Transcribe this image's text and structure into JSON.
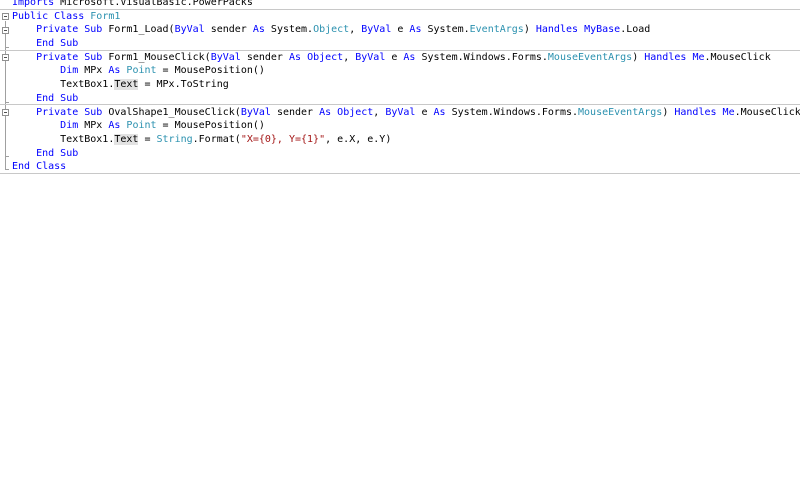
{
  "editor": {
    "language": "VB.NET",
    "colors": {
      "keyword": "#0000ff",
      "type": "#2b91af",
      "string": "#a31515",
      "text": "#000000",
      "highlight": "#e2e2e2"
    },
    "lines": [
      [
        [
          "kw",
          "Imports"
        ],
        [
          "t",
          " Microsoft.VisualBasic.PowerPacks"
        ]
      ],
      [
        [
          "kw",
          "Public Class"
        ],
        [
          "t",
          " "
        ],
        [
          "ty",
          "Form1"
        ]
      ],
      [
        [
          "t",
          "    "
        ],
        [
          "kw",
          "Private Sub"
        ],
        [
          "t",
          " Form1_Load("
        ],
        [
          "kw",
          "ByVal"
        ],
        [
          "t",
          " sender "
        ],
        [
          "kw",
          "As"
        ],
        [
          "t",
          " System."
        ],
        [
          "ty",
          "Object"
        ],
        [
          "t",
          ", "
        ],
        [
          "kw",
          "ByVal"
        ],
        [
          "t",
          " e "
        ],
        [
          "kw",
          "As"
        ],
        [
          "t",
          " System."
        ],
        [
          "ty",
          "EventArgs"
        ],
        [
          "t",
          ") "
        ],
        [
          "kw",
          "Handles"
        ],
        [
          "t",
          " "
        ],
        [
          "kw",
          "MyBase"
        ],
        [
          "t",
          ".Load"
        ]
      ],
      [
        [
          "t",
          "    "
        ],
        [
          "kw",
          "End Sub"
        ]
      ],
      [
        [
          "t",
          "    "
        ],
        [
          "kw",
          "Private Sub"
        ],
        [
          "t",
          " Form1_MouseClick("
        ],
        [
          "kw",
          "ByVal"
        ],
        [
          "t",
          " sender "
        ],
        [
          "kw",
          "As"
        ],
        [
          "t",
          " "
        ],
        [
          "kw",
          "Object"
        ],
        [
          "t",
          ", "
        ],
        [
          "kw",
          "ByVal"
        ],
        [
          "t",
          " e "
        ],
        [
          "kw",
          "As"
        ],
        [
          "t",
          " System.Windows.Forms."
        ],
        [
          "ty",
          "MouseEventArgs"
        ],
        [
          "t",
          ") "
        ],
        [
          "kw",
          "Handles"
        ],
        [
          "t",
          " "
        ],
        [
          "kw",
          "Me"
        ],
        [
          "t",
          ".MouseClick"
        ]
      ],
      [
        [
          "t",
          "        "
        ],
        [
          "kw",
          "Dim"
        ],
        [
          "t",
          " MPx "
        ],
        [
          "kw",
          "As"
        ],
        [
          "t",
          " "
        ],
        [
          "ty",
          "Point"
        ],
        [
          "t",
          " = MousePosition()"
        ]
      ],
      [
        [
          "t",
          "        TextBox1."
        ],
        [
          "hl",
          "Text"
        ],
        [
          "t",
          " = MPx.ToString"
        ]
      ],
      [
        [
          "t",
          "    "
        ],
        [
          "kw",
          "End Sub"
        ]
      ],
      [
        [
          "t",
          "    "
        ],
        [
          "kw",
          "Private Sub"
        ],
        [
          "t",
          " OvalShape1_MouseClick("
        ],
        [
          "kw",
          "ByVal"
        ],
        [
          "t",
          " sender "
        ],
        [
          "kw",
          "As"
        ],
        [
          "t",
          " "
        ],
        [
          "kw",
          "Object"
        ],
        [
          "t",
          ", "
        ],
        [
          "kw",
          "ByVal"
        ],
        [
          "t",
          " e "
        ],
        [
          "kw",
          "As"
        ],
        [
          "t",
          " System.Windows.Forms."
        ],
        [
          "ty",
          "MouseEventArgs"
        ],
        [
          "t",
          ") "
        ],
        [
          "kw",
          "Handles"
        ],
        [
          "t",
          " "
        ],
        [
          "kw",
          "Me"
        ],
        [
          "t",
          ".MouseClick"
        ]
      ],
      [
        [
          "t",
          "        "
        ],
        [
          "kw",
          "Dim"
        ],
        [
          "t",
          " MPx "
        ],
        [
          "kw",
          "As"
        ],
        [
          "t",
          " "
        ],
        [
          "ty",
          "Point"
        ],
        [
          "t",
          " = MousePosition()"
        ]
      ],
      [
        [
          "t",
          "        TextBox1."
        ],
        [
          "hl",
          "Text"
        ],
        [
          "t",
          " = "
        ],
        [
          "ty",
          "String"
        ],
        [
          "t",
          ".Format("
        ],
        [
          "st",
          "\"X={0}, Y={1}\""
        ],
        [
          "t",
          ", e.X, e.Y)"
        ]
      ],
      [
        [
          "t",
          "    "
        ],
        [
          "kw",
          "End Sub"
        ]
      ],
      [
        [
          "kw",
          "End Class"
        ]
      ]
    ]
  }
}
